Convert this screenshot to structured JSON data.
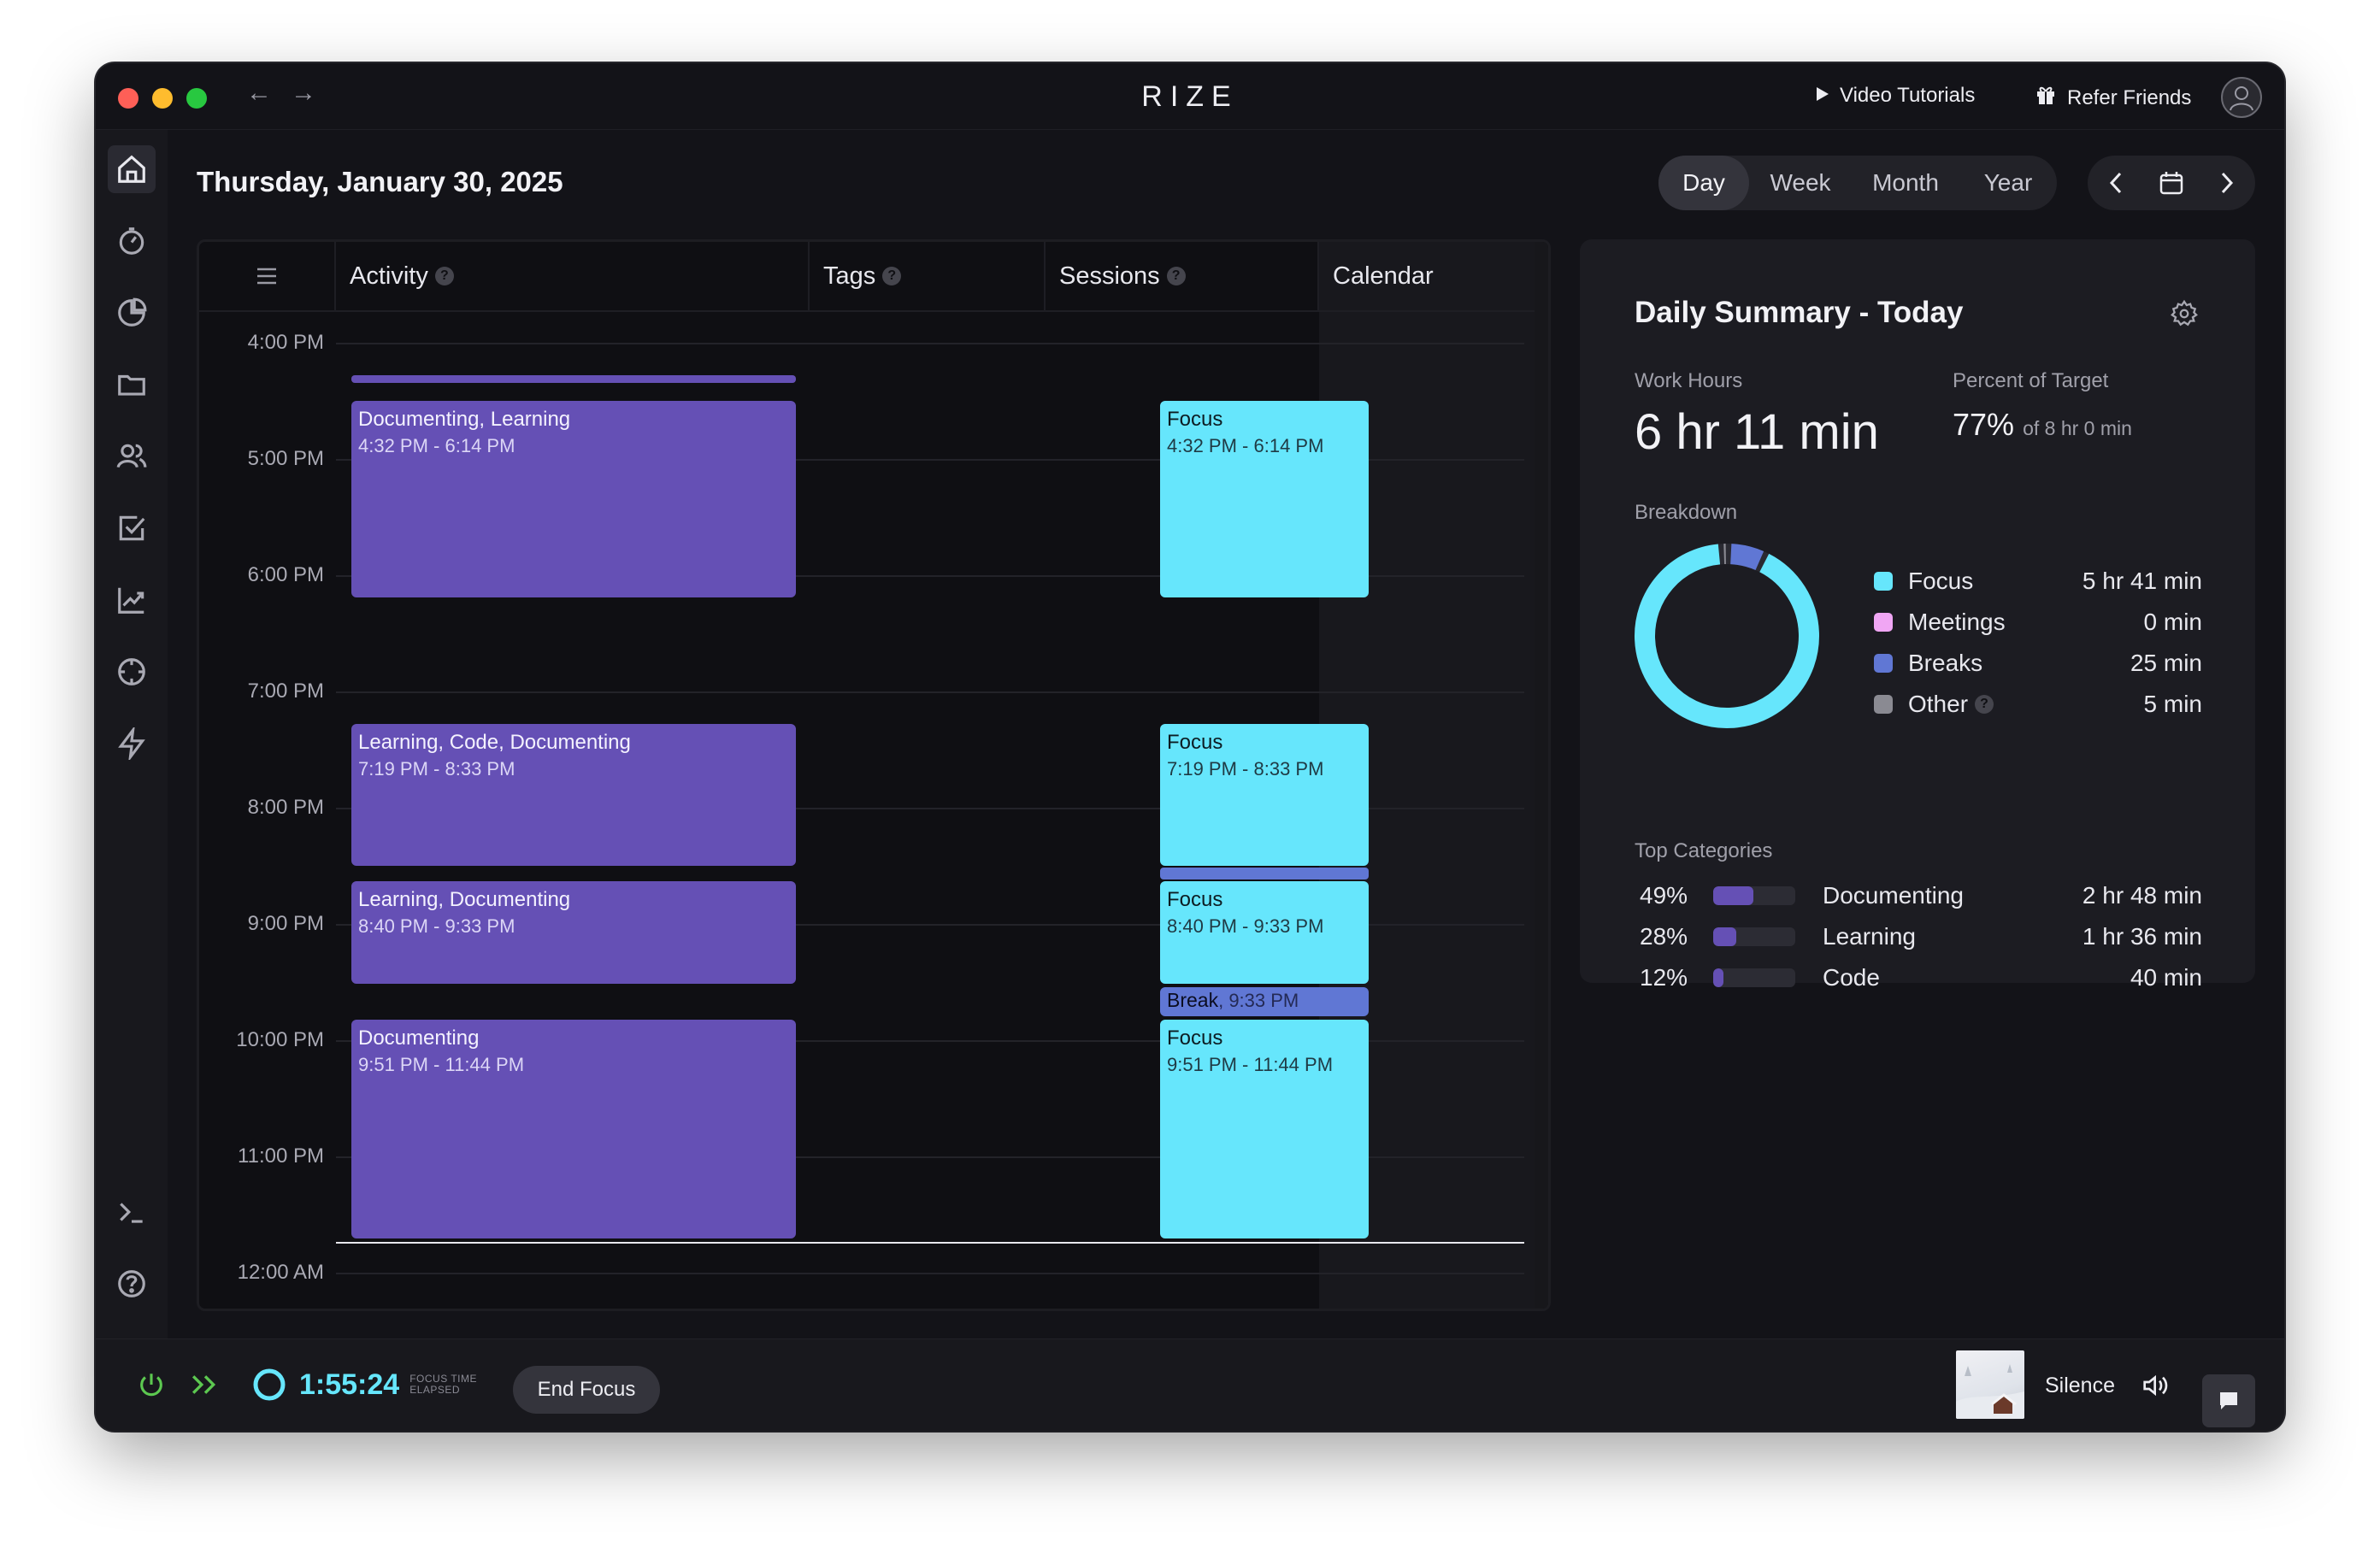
{
  "app": {
    "title": "RIZE",
    "video_tutorials": "Video Tutorials",
    "refer_friends": "Refer Friends"
  },
  "sidebar": {
    "items": [
      "home-icon",
      "timer-icon",
      "pie-chart-icon",
      "folder-icon",
      "users-icon",
      "checkbox-icon",
      "trend-chart-icon",
      "crosshair-icon",
      "lightning-icon",
      "terminal-icon",
      "help-icon",
      "settings-icon"
    ]
  },
  "header": {
    "date": "Thursday, January 30, 2025",
    "range_tabs": [
      "Day",
      "Week",
      "Month",
      "Year"
    ],
    "active_tab": "Day"
  },
  "calendar": {
    "columns": {
      "activity": "Activity",
      "tags": "Tags",
      "sessions": "Sessions",
      "calendar": "Calendar"
    },
    "hours": [
      "4:00 PM",
      "5:00 PM",
      "6:00 PM",
      "7:00 PM",
      "8:00 PM",
      "9:00 PM",
      "10:00 PM",
      "11:00 PM",
      "12:00 AM"
    ],
    "activities": [
      {
        "title": "Documenting, Learning",
        "time": "4:32 PM - 6:14 PM"
      },
      {
        "title": "Learning, Code, Documenting",
        "time": "7:19 PM - 8:33 PM"
      },
      {
        "title": "Learning, Documenting",
        "time": "8:40 PM - 9:33 PM"
      },
      {
        "title": "Documenting",
        "time": "9:51 PM - 11:44 PM"
      }
    ],
    "sessions": [
      {
        "title": "Focus",
        "time": "4:32 PM - 6:14 PM"
      },
      {
        "title": "Focus",
        "time": "7:19 PM - 8:33 PM"
      },
      {
        "title": "Focus",
        "time": "8:40 PM - 9:33 PM"
      },
      {
        "title": "Focus",
        "time": "9:51 PM - 11:44 PM"
      }
    ],
    "break": {
      "title": "Break",
      "time": ", 9:33 PM"
    }
  },
  "summary": {
    "title": "Daily Summary - Today",
    "work_hours_label": "Work Hours",
    "work_hours": "6 hr 11 min",
    "percent_label": "Percent of Target",
    "percent": "77%",
    "percent_of": "of 8 hr 0 min",
    "breakdown_label": "Breakdown",
    "breakdown": [
      {
        "name": "Focus",
        "value": "5 hr 41 min",
        "color": "#66e6fc"
      },
      {
        "name": "Meetings",
        "value": "0 min",
        "color": "#f0a6f4"
      },
      {
        "name": "Breaks",
        "value": "25 min",
        "color": "#6077d4"
      },
      {
        "name": "Other",
        "value": "5 min",
        "color": "#8a8a92"
      }
    ],
    "top_categories_label": "Top Categories",
    "top_categories": [
      {
        "pct": "49%",
        "name": "Documenting",
        "value": "2 hr 48 min",
        "fraction": 0.49
      },
      {
        "pct": "28%",
        "name": "Learning",
        "value": "1 hr 36 min",
        "fraction": 0.28
      },
      {
        "pct": "12%",
        "name": "Code",
        "value": "40 min",
        "fraction": 0.12
      }
    ]
  },
  "bottom": {
    "timer": "1:55:24",
    "timer_caption_1": "FOCUS TIME",
    "timer_caption_2": "ELAPSED",
    "end_focus": "End Focus",
    "music": "Silence"
  }
}
